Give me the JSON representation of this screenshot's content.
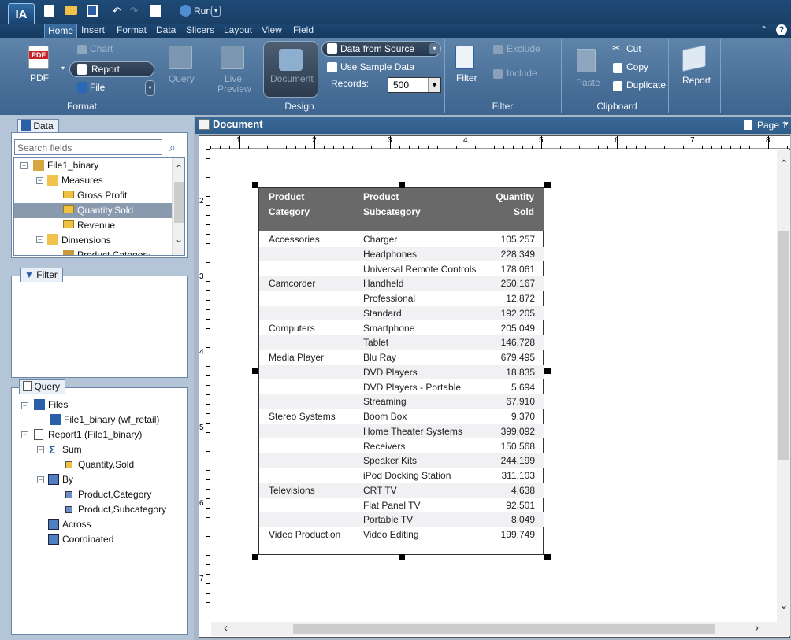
{
  "app": {
    "logo": "IA",
    "run_label": "Run"
  },
  "menu": {
    "tabs": [
      "Home",
      "Insert",
      "Format",
      "Data",
      "Slicers",
      "Layout",
      "View",
      "Field"
    ],
    "active": "Home"
  },
  "ribbon": {
    "format": {
      "pdf": "PDF",
      "chart": "Chart",
      "report": "Report",
      "file": "File",
      "group": "Format"
    },
    "design": {
      "query": "Query",
      "live_preview_1": "Live",
      "live_preview_2": "Preview",
      "document": "Document",
      "data_from_source": "Data from Source",
      "use_sample_data": "Use Sample Data",
      "records_label": "Records:",
      "records_value": "500",
      "group": "Design"
    },
    "filter": {
      "filter": "Filter",
      "exclude": "Exclude",
      "include": "Include",
      "group": "Filter"
    },
    "clipboard": {
      "paste": "Paste",
      "cut": "Cut",
      "copy": "Copy",
      "duplicate": "Duplicate",
      "group": "Clipboard"
    },
    "report": {
      "report": "Report"
    }
  },
  "data_panel": {
    "title": "Data",
    "search_placeholder": "Search fields",
    "tree": {
      "root": "File1_binary",
      "measures": "Measures",
      "m1": "Gross Profit",
      "m2": "Quantity,Sold",
      "m3": "Revenue",
      "dimensions": "Dimensions",
      "d1": "Product,Category"
    }
  },
  "filter_panel": {
    "title": "Filter"
  },
  "query_panel": {
    "title": "Query",
    "files": "Files",
    "file1": "File1_binary (wf_retail)",
    "report": "Report1 (File1_binary)",
    "sum": "Sum",
    "sum_field": "Quantity,Sold",
    "by": "By",
    "by1": "Product,Category",
    "by2": "Product,Subcategory",
    "across": "Across",
    "coordinated": "Coordinated"
  },
  "document": {
    "title": "Document",
    "page": "Page 1"
  },
  "ruler": {
    "h": [
      "1",
      "2",
      "3",
      "4",
      "5",
      "6",
      "7",
      "8"
    ],
    "v": [
      "2",
      "3",
      "4",
      "5",
      "6",
      "7"
    ]
  },
  "report_table": {
    "headers": {
      "c1a": "Product",
      "c1b": "Category",
      "c2a": "Product",
      "c2b": "Subcategory",
      "c3a": "Quantity",
      "c3b": "Sold"
    },
    "rows": [
      {
        "cat": "Accessories",
        "sub": "Charger",
        "qty": "105,257"
      },
      {
        "cat": "",
        "sub": "Headphones",
        "qty": "228,349"
      },
      {
        "cat": "",
        "sub": "Universal Remote Controls",
        "qty": "178,061"
      },
      {
        "cat": "Camcorder",
        "sub": "Handheld",
        "qty": "250,167"
      },
      {
        "cat": "",
        "sub": "Professional",
        "qty": "12,872"
      },
      {
        "cat": "",
        "sub": "Standard",
        "qty": "192,205"
      },
      {
        "cat": "Computers",
        "sub": "Smartphone",
        "qty": "205,049"
      },
      {
        "cat": "",
        "sub": "Tablet",
        "qty": "146,728"
      },
      {
        "cat": "Media Player",
        "sub": "Blu Ray",
        "qty": "679,495"
      },
      {
        "cat": "",
        "sub": "DVD Players",
        "qty": "18,835"
      },
      {
        "cat": "",
        "sub": "DVD Players - Portable",
        "qty": "5,694"
      },
      {
        "cat": "",
        "sub": "Streaming",
        "qty": "67,910"
      },
      {
        "cat": "Stereo Systems",
        "sub": "Boom Box",
        "qty": "9,370"
      },
      {
        "cat": "",
        "sub": "Home Theater Systems",
        "qty": "399,092"
      },
      {
        "cat": "",
        "sub": "Receivers",
        "qty": "150,568"
      },
      {
        "cat": "",
        "sub": "Speaker Kits",
        "qty": "244,199"
      },
      {
        "cat": "",
        "sub": "iPod Docking Station",
        "qty": "311,103"
      },
      {
        "cat": "Televisions",
        "sub": "CRT TV",
        "qty": "4,638"
      },
      {
        "cat": "",
        "sub": "Flat Panel TV",
        "qty": "92,501"
      },
      {
        "cat": "",
        "sub": "Portable TV",
        "qty": "8,049"
      },
      {
        "cat": "Video Production",
        "sub": "Video Editing",
        "qty": "199,749"
      }
    ]
  }
}
